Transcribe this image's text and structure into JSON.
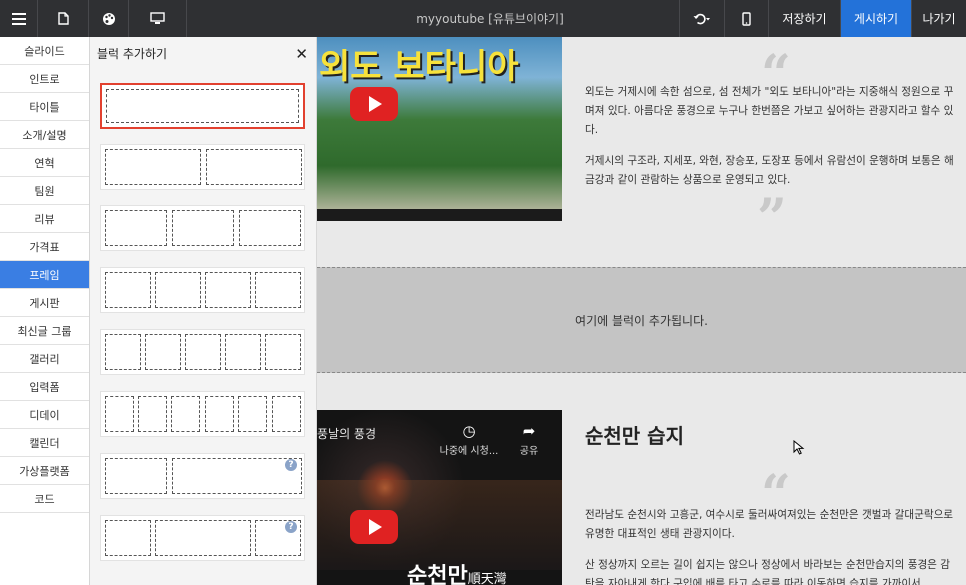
{
  "topbar": {
    "title": "myyoutube [유튜브이야기]",
    "save_label": "저장하기",
    "publish_label": "게시하기",
    "exit_label": "나가기",
    "icons": [
      "menu-icon",
      "page-icon",
      "palette-icon",
      "desktop-icon",
      "undo-icon",
      "mobile-icon"
    ],
    "publish_color": "#2372d9"
  },
  "categories": {
    "items": [
      "슬라이드",
      "인트로",
      "타이틀",
      "소개/설명",
      "연혁",
      "팀원",
      "리뷰",
      "가격표",
      "프레임",
      "게시판",
      "최신글 그룹",
      "갤러리",
      "입력폼",
      "디데이",
      "캘린더",
      "가상플랫폼",
      "코드"
    ],
    "active": "프레임",
    "active_color": "#3a7ee3"
  },
  "panel": {
    "title": "블럭 추가하기",
    "close_icon": "close-icon",
    "layout_count_visible": 8
  },
  "canvas": {
    "section1": {
      "video_title": "외도 보타니아",
      "paragraph1": "외도는 거제시에 속한 섬으로, 섬 전체가 \"외도 보타니아\"라는 지중해식 정원으로 꾸며져 있다. 아름다운 풍경으로 누구나 한번쯤은 가보고 싶어하는 관광지라고 할수 있다.",
      "paragraph2": "거제시의 구조라, 지세포, 와현, 장승포, 도장포 등에서 유람선이 운행하며 보통은 해금강과 같이 관람하는 상품으로 운영되고 있다."
    },
    "drop_zone_text": "여기에 블럭이 추가됩니다.",
    "section2": {
      "heading": "순천만 습지",
      "video_label": "풍날의 풍경",
      "watch_later": "나중에 시청...",
      "share": "공유",
      "video_big_title": "순천만",
      "video_big_title_hanja": "順天灣",
      "paragraph1": "전라남도 순천시와 고흥군, 여수시로 둘러싸여져있는 순천만은 갯벌과 갈대군락으로 유명한 대표적인 생태 관광지이다.",
      "paragraph2": "산 정상까지 오르는 길이 쉽지는 않으나 정상에서 바라보는 순천만습지의 풍경은 감탄을 자아내게 한다 구입에 배를 타고 수로를 따라 이동하면 습지를 가까이서"
    },
    "quote_open": "“",
    "quote_close": "”"
  }
}
